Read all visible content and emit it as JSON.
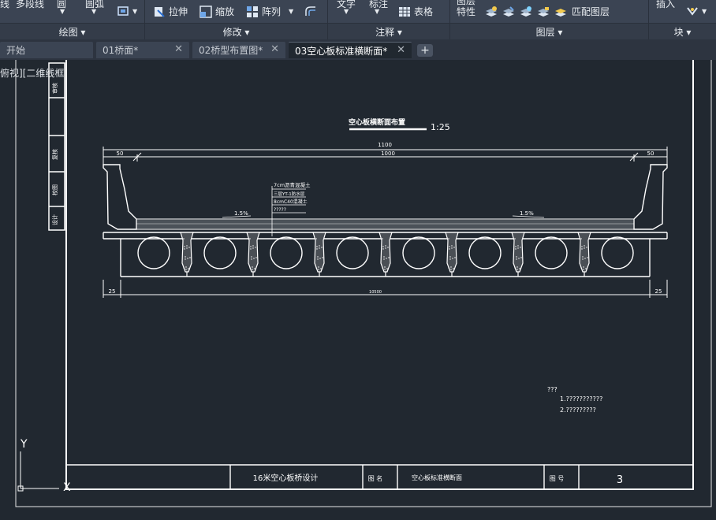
{
  "ribbon": {
    "draw_items": [
      "线",
      "多段线",
      "圆",
      "圆弧"
    ],
    "modify_items": [
      "拉伸",
      "缩放",
      "阵列"
    ],
    "annotate_items": [
      "文字",
      "标注",
      "表格"
    ],
    "layer_items": [
      "图层",
      "特性",
      "匹配图层"
    ],
    "block_items": [
      "插入"
    ],
    "panels": [
      "绘图 ▾",
      "修改 ▾",
      "注释 ▾",
      "图层 ▾",
      "块 ▾"
    ]
  },
  "tabs": [
    {
      "label": "开始"
    },
    {
      "label": "01桥面*"
    },
    {
      "label": "02桥型布置图*"
    },
    {
      "label": "03空心板标准横断面*",
      "active": true
    }
  ],
  "viewport": {
    "label": "俯视][二维线框"
  },
  "drawing": {
    "title": "空心板横断面布置",
    "scale": "1:25",
    "dims": {
      "total": "1100",
      "left_edge": "50",
      "middle": "1000",
      "right_edge": "50",
      "bottom_left": "25",
      "bottom_mid": "10500",
      "bottom_right": "25"
    },
    "slope_left": "1.5%",
    "slope_right": "1.5%",
    "layers_note": {
      "line1": "7cm沥青混凝土",
      "line2": "三层YT-1防水层",
      "line3": "8cmC40混凝土",
      "line4": "?????"
    },
    "notes_title": "???",
    "note1": "1.???????????",
    "note2": "2.?????????",
    "side_strip": [
      "审核",
      "复核",
      "校图",
      "设计"
    ],
    "titleblock": {
      "project": "16米空心板桥设计",
      "drawing_label": "图 名",
      "drawing_name": "空心板标准横断面",
      "sheet_label": "图 号",
      "sheet_no": "3"
    },
    "ucs": {
      "y": "Y",
      "x": "X"
    }
  }
}
